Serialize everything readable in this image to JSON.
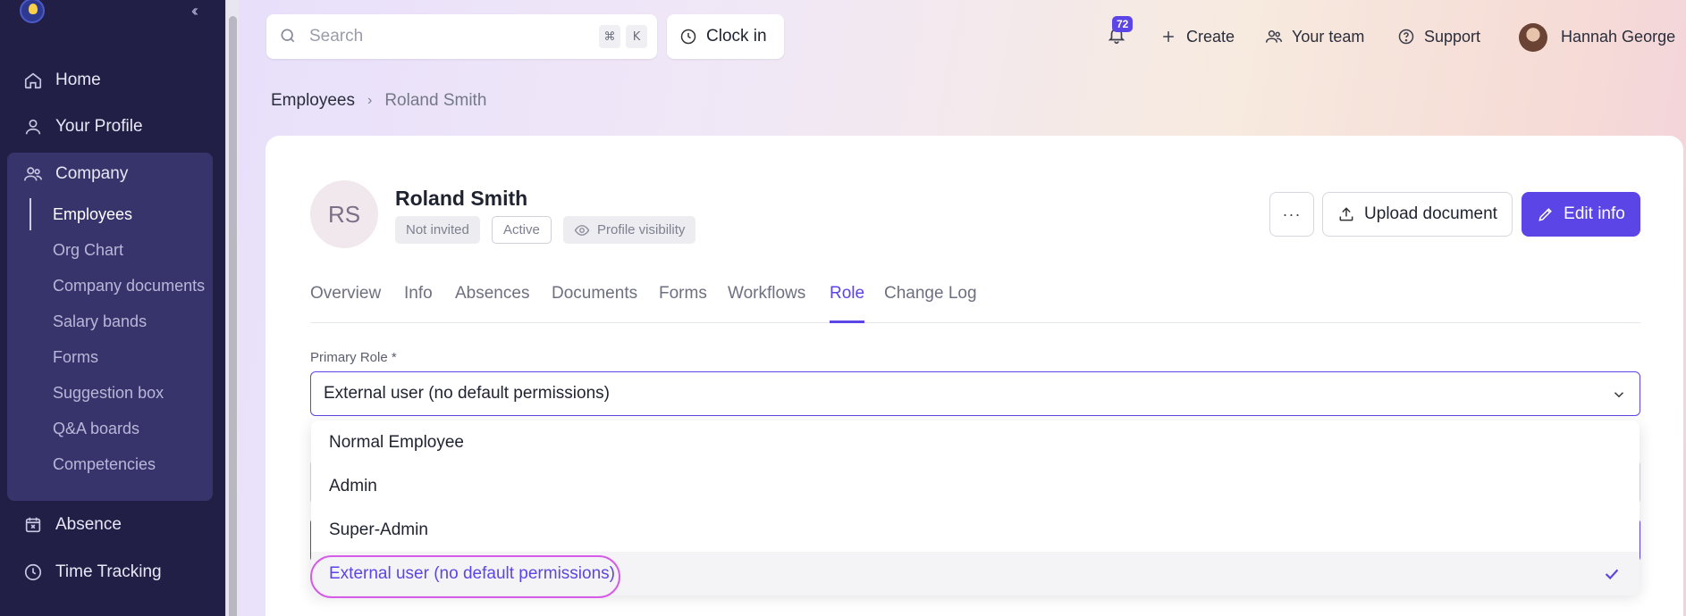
{
  "sidebar": {
    "main_items": [
      {
        "label": "Home",
        "icon": "home-icon"
      },
      {
        "label": "Your Profile",
        "icon": "user-icon"
      },
      {
        "label": "Company",
        "icon": "people-icon"
      }
    ],
    "company_items": [
      {
        "label": "Employees",
        "active": true
      },
      {
        "label": "Org Chart"
      },
      {
        "label": "Company documents"
      },
      {
        "label": "Salary bands"
      },
      {
        "label": "Forms"
      },
      {
        "label": "Suggestion box"
      },
      {
        "label": "Q&A boards"
      },
      {
        "label": "Competencies"
      }
    ],
    "lower_items": [
      {
        "label": "Absence",
        "icon": "calendar-x-icon"
      },
      {
        "label": "Time Tracking",
        "icon": "clock-icon"
      }
    ]
  },
  "topbar": {
    "search_placeholder": "Search",
    "shortcut_keys": [
      "⌘",
      "K"
    ],
    "clock_in_label": "Clock in",
    "notification_count": "72",
    "create_label": "Create",
    "team_label": "Your team",
    "support_label": "Support",
    "user_name": "Hannah George"
  },
  "breadcrumb": {
    "parent": "Employees",
    "current": "Roland Smith"
  },
  "employee": {
    "initials": "RS",
    "name": "Roland Smith",
    "status_pills": [
      "Not invited",
      "Active"
    ],
    "visibility_label": "Profile visibility"
  },
  "actions": {
    "more_label": "···",
    "upload_label": "Upload document",
    "edit_label": "Edit info"
  },
  "tabs": [
    "Overview",
    "Info",
    "Absences",
    "Documents",
    "Forms",
    "Workflows",
    "Role",
    "Change Log"
  ],
  "active_tab": "Role",
  "role_form": {
    "label": "Primary Role *",
    "selected_value": "External user (no default permissions)",
    "options": [
      "Normal Employee",
      "Admin",
      "Super-Admin",
      "External user (no default permissions)"
    ]
  },
  "colors": {
    "accent": "#5b45e6",
    "sidebar": "#221f47",
    "highlight_ring": "#d65be8"
  }
}
